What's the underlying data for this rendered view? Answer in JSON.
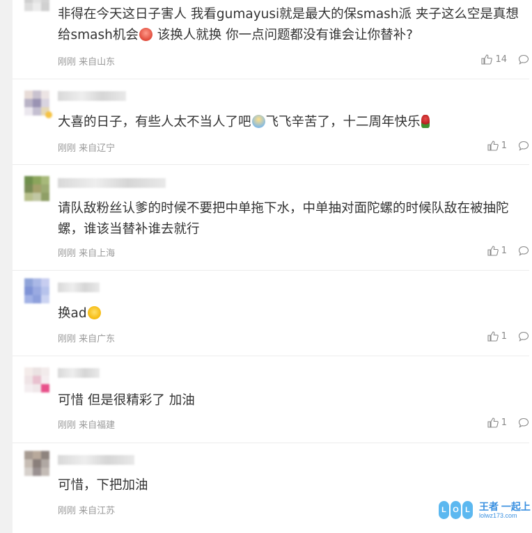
{
  "comments": [
    {
      "text_before": "非得在今天这日子害人 我看gumayusi就是最大的保smash派 夹子这么空是真想给smash机会",
      "emoji": "angry-face",
      "text_after": " 该换人就换 你一点问题都没有谁会让你替补?",
      "meta": "刚刚 来自山东",
      "likes": "14",
      "avatar_colors": [
        "#d8d8d8",
        "#c9c9c9",
        "#e6e6e6",
        "#cfcfcf",
        "#e2e2e2",
        "#d4d4d4",
        "#dddddd",
        "#ececec",
        "#d0d0d0"
      ]
    },
    {
      "text_before": "大喜的日子，有些人太不当人了吧",
      "emoji": "baby-face",
      "text_after": "飞飞辛苦了，十二周年快乐",
      "emoji2": "rose",
      "meta": "刚刚 来自辽宁",
      "likes": "1",
      "avatar_colors": [
        "#e8dcd8",
        "#c9c2cf",
        "#ece4e4",
        "#b9b3c6",
        "#9a93b3",
        "#d9d4e0",
        "#ebe7ee",
        "#c4bfd1",
        "#e6d8b6"
      ]
    },
    {
      "text": "请队敌粉丝认爹的时候不要把中单拖下水，中单抽对面陀螺的时候队敌在被抽陀螺，谁该当替补谁去就行",
      "meta": "刚刚 来自上海",
      "likes": "1",
      "avatar_colors": [
        "#6f8f4c",
        "#8ba55c",
        "#a7b97a",
        "#7a8c56",
        "#a3a06b",
        "#9cab72",
        "#b8c08c",
        "#c1c7a3",
        "#8f9f66"
      ]
    },
    {
      "text_before": "换ad",
      "emoji": "smile-face",
      "text_after": "",
      "meta": "刚刚 来自广东",
      "likes": "1",
      "avatar_colors": [
        "#8fa3d9",
        "#aab8e6",
        "#c7cdf0",
        "#7f93d6",
        "#9aaae1",
        "#b7c3ec",
        "#a1b1e5",
        "#8ea0dc",
        "#cbd3f2"
      ]
    },
    {
      "text": "可惜 但是很精彩了 加油",
      "meta": "刚刚 来自福建",
      "likes": "1",
      "avatar_colors": [
        "#f4ecea",
        "#ebe3e3",
        "#f2ebeb",
        "#efe4e6",
        "#e9c1cf",
        "#f5eef0",
        "#f4eef0",
        "#f0e8ea",
        "#e8508a"
      ]
    },
    {
      "text": "可惜，下把加油",
      "meta": "刚刚 来自江苏",
      "likes": "",
      "avatar_colors": [
        "#a79b92",
        "#b8a99b",
        "#8e847e",
        "#c7bdb4",
        "#8a7f7b",
        "#b0a8a3",
        "#d6d0cb",
        "#9a9191",
        "#c4bcb6"
      ]
    }
  ],
  "watermark": {
    "logo_letters": [
      "L",
      "O",
      "L"
    ],
    "brand": "王者 一起上",
    "url": "lolwz173.com"
  },
  "colors": {
    "text": "#333333",
    "meta": "#999999",
    "divider": "#ececec",
    "accent": "#3a90e0"
  },
  "icons": {
    "like": "thumbs-up-icon",
    "reply": "comment-bubble-icon"
  }
}
